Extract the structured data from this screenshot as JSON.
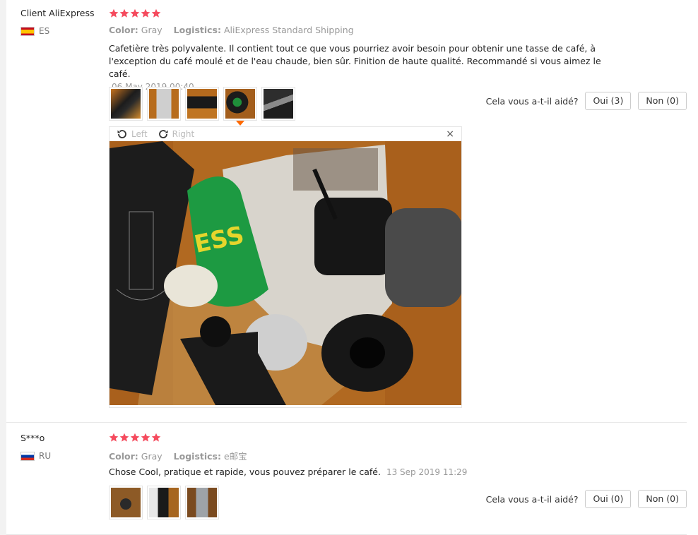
{
  "helpful_question": "Cela vous a-t-il aidé?",
  "viewer": {
    "left_label": "Left",
    "right_label": "Right",
    "close_label": "×"
  },
  "reviews": [
    {
      "user": "Client AliExpress",
      "country": "ES",
      "stars": 5,
      "color_label": "Color:",
      "color_value": "Gray",
      "logistics_label": "Logistics:",
      "logistics_value": "AliExpress Standard Shipping",
      "text": "Cafetière très polyvalente. Il contient tout ce que vous pourriez avoir besoin pour obtenir une tasse de café, à l'exception du café moulé et de l'eau chaude, bien sûr. Finition de haute qualité. Recommandé si vous aimez le café.",
      "date": "06 May 2019 00:40",
      "yes_label": "Oui (3)",
      "no_label": "Non (0)",
      "photo_text": "ESS"
    },
    {
      "user": "S***o",
      "country": "RU",
      "stars": 5,
      "color_label": "Color:",
      "color_value": "Gray",
      "logistics_label": "Logistics:",
      "logistics_value": "e邮宝",
      "text": "Chose Cool, pratique et rapide, vous pouvez préparer le café.",
      "date": "13 Sep 2019 11:29",
      "yes_label": "Oui (0)",
      "no_label": "Non (0)"
    }
  ]
}
